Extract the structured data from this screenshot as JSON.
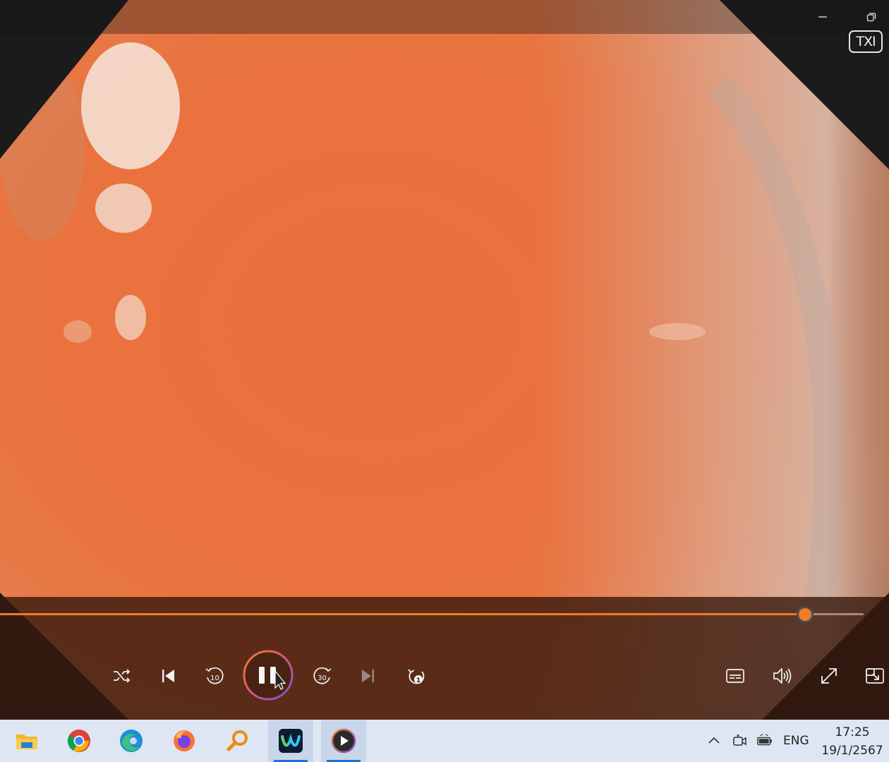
{
  "window": {
    "minimize_label": "Minimize",
    "restore_label": "Restore"
  },
  "video": {
    "overlay_badge": "TXI"
  },
  "player": {
    "progress": 0.905,
    "accent_color": "#f07a2c",
    "controls": {
      "shuffle": "shuffle-icon",
      "previous": "previous-track-icon",
      "rewind": "rewind-10-icon",
      "play_pause": "pause-icon",
      "forward": "forward-30-icon",
      "next": "next-track-icon",
      "repeat": "repeat-one-icon",
      "subtitles": "subtitles-icon",
      "volume": "volume-icon",
      "fullscreen": "fullscreen-icon",
      "mini_player": "mini-player-icon"
    }
  },
  "taskbar": {
    "apps": [
      {
        "name": "File Explorer",
        "icon": "file-explorer-icon",
        "active": false
      },
      {
        "name": "Google Chrome",
        "icon": "chrome-icon",
        "active": false
      },
      {
        "name": "Microsoft Edge",
        "icon": "edge-icon",
        "active": false
      },
      {
        "name": "Firefox",
        "icon": "firefox-icon",
        "active": false
      },
      {
        "name": "Search",
        "icon": "search-icon",
        "active": false
      },
      {
        "name": "Webex",
        "icon": "webex-icon",
        "active": true
      },
      {
        "name": "Media Player",
        "icon": "media-player-icon",
        "active": true
      }
    ],
    "tray": {
      "language": "ENG",
      "time": "17:25",
      "date": "19/1/2567"
    }
  }
}
